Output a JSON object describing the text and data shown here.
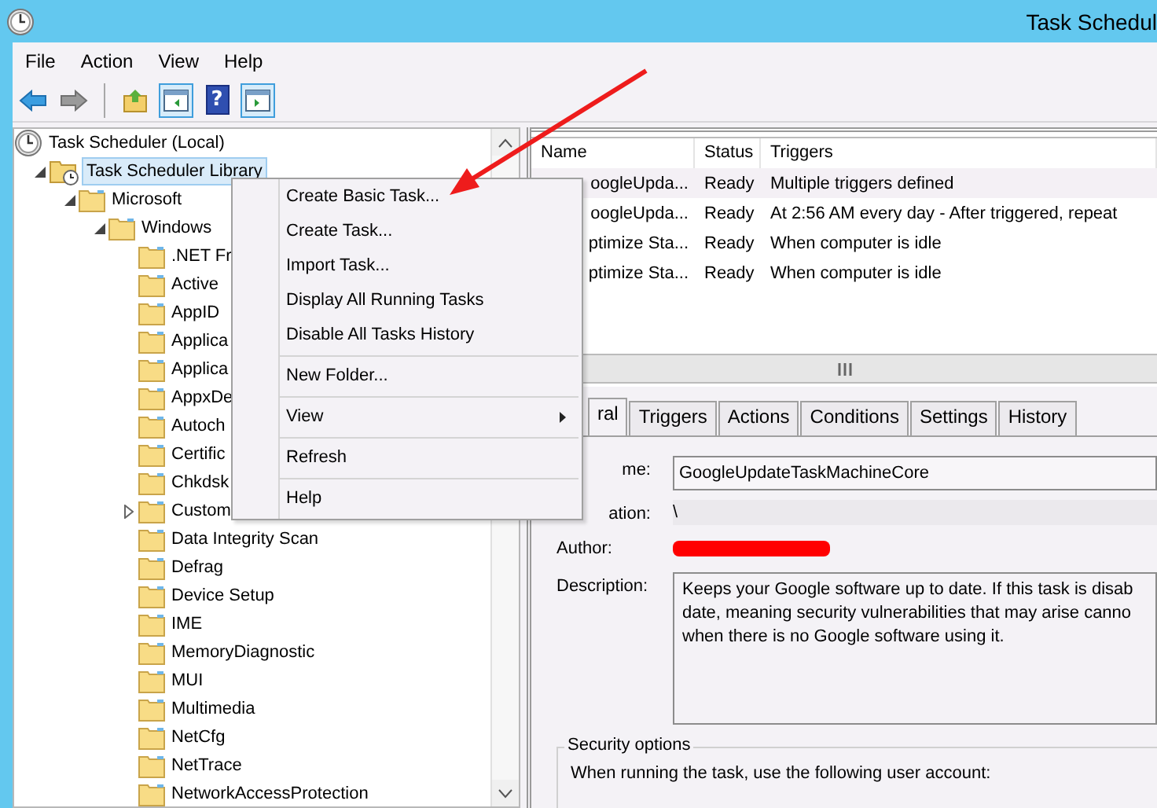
{
  "window": {
    "title": "Task Schedul"
  },
  "menu_bar": [
    "File",
    "Action",
    "View",
    "Help"
  ],
  "toolbar": [
    {
      "kind": "back",
      "pressed": false
    },
    {
      "kind": "forward",
      "pressed": false
    },
    {
      "kind": "separator"
    },
    {
      "kind": "up",
      "pressed": false
    },
    {
      "kind": "tree-toggle",
      "pressed": true
    },
    {
      "kind": "help",
      "pressed": false,
      "glyph": "?"
    },
    {
      "kind": "action-toggle",
      "pressed": true
    }
  ],
  "tree": [
    {
      "label": "Task Scheduler (Local)",
      "kind": "console",
      "selected": false,
      "children": [
        {
          "label": "Task Scheduler Library",
          "kind": "library",
          "expanded": true,
          "selected": true,
          "children": [
            {
              "label": "Microsoft",
              "kind": "folder",
              "expanded": true,
              "selected": false,
              "children": [
                {
                  "label": "Windows",
                  "kind": "folder",
                  "expanded": true,
                  "selected": false,
                  "children": [
                    {
                      "label": ".NET Fr",
                      "kind": "folder",
                      "selected": false
                    },
                    {
                      "label": "Active",
                      "kind": "folder",
                      "selected": false
                    },
                    {
                      "label": "AppID",
                      "kind": "folder",
                      "selected": false
                    },
                    {
                      "label": "Applica",
                      "kind": "folder",
                      "selected": false
                    },
                    {
                      "label": "Applica",
                      "kind": "folder",
                      "selected": false
                    },
                    {
                      "label": "AppxDe",
                      "kind": "folder",
                      "selected": false
                    },
                    {
                      "label": "Autoch",
                      "kind": "folder",
                      "selected": false
                    },
                    {
                      "label": "Certific",
                      "kind": "folder",
                      "selected": false
                    },
                    {
                      "label": "Chkdsk",
                      "kind": "folder",
                      "selected": false
                    },
                    {
                      "label": "Custom",
                      "kind": "folder",
                      "expanded": false,
                      "selected": false
                    },
                    {
                      "label": "Data Integrity Scan",
                      "kind": "folder",
                      "selected": false
                    },
                    {
                      "label": "Defrag",
                      "kind": "folder",
                      "selected": false
                    },
                    {
                      "label": "Device Setup",
                      "kind": "folder",
                      "selected": false
                    },
                    {
                      "label": "IME",
                      "kind": "folder",
                      "selected": false
                    },
                    {
                      "label": "MemoryDiagnostic",
                      "kind": "folder",
                      "selected": false
                    },
                    {
                      "label": "MUI",
                      "kind": "folder",
                      "selected": false
                    },
                    {
                      "label": "Multimedia",
                      "kind": "folder",
                      "selected": false
                    },
                    {
                      "label": "NetCfg",
                      "kind": "folder",
                      "selected": false
                    },
                    {
                      "label": "NetTrace",
                      "kind": "folder",
                      "selected": false
                    },
                    {
                      "label": "NetworkAccessProtection",
                      "kind": "folder",
                      "selected": false
                    }
                  ]
                }
              ]
            }
          ]
        }
      ]
    }
  ],
  "table": {
    "columns": [
      "Name",
      "Status",
      "Triggers"
    ],
    "rows": [
      {
        "cells": [
          "oogleUpda...",
          "Ready",
          "Multiple triggers defined"
        ],
        "selected": true
      },
      {
        "cells": [
          "oogleUpda...",
          "Ready",
          "At 2:56 AM every day - After triggered, repeat"
        ],
        "selected": false
      },
      {
        "cells": [
          "ptimize Sta...",
          "Ready",
          "When computer is idle"
        ],
        "selected": false
      },
      {
        "cells": [
          "ptimize Sta...",
          "Ready",
          "When computer is idle"
        ],
        "selected": false
      }
    ]
  },
  "details": {
    "tabs": [
      {
        "label": "ral",
        "selected": true
      },
      {
        "label": "Triggers",
        "selected": false
      },
      {
        "label": "Actions",
        "selected": false
      },
      {
        "label": "Conditions",
        "selected": false
      },
      {
        "label": "Settings",
        "selected": false
      },
      {
        "label": "History",
        "selected": false
      }
    ],
    "fields": [
      {
        "kind": "box",
        "label": "me:",
        "value": "GoogleUpdateTaskMachineCore"
      },
      {
        "kind": "plain",
        "label": "ation:",
        "value": "\\"
      },
      {
        "kind": "redacted",
        "label": "Author:"
      },
      {
        "kind": "multiline",
        "label": "Description:",
        "lines": [
          "Keeps your Google software up to date. If this task is disab",
          "date, meaning security vulnerabilities that may arise canno",
          "when there is no Google software using it."
        ]
      }
    ],
    "security": {
      "title": "Security options",
      "text": "When running the task, use the following user account:"
    }
  },
  "context_menu": [
    {
      "kind": "item",
      "label": "Create Basic Task..."
    },
    {
      "kind": "item",
      "label": "Create Task..."
    },
    {
      "kind": "item",
      "label": "Import Task..."
    },
    {
      "kind": "item",
      "label": "Display All Running Tasks"
    },
    {
      "kind": "item",
      "label": "Disable All Tasks History"
    },
    {
      "kind": "separator"
    },
    {
      "kind": "item",
      "label": "New Folder..."
    },
    {
      "kind": "separator"
    },
    {
      "kind": "submenu",
      "label": "View"
    },
    {
      "kind": "separator"
    },
    {
      "kind": "item",
      "label": "Refresh"
    },
    {
      "kind": "separator"
    },
    {
      "kind": "item",
      "label": "Help"
    }
  ]
}
